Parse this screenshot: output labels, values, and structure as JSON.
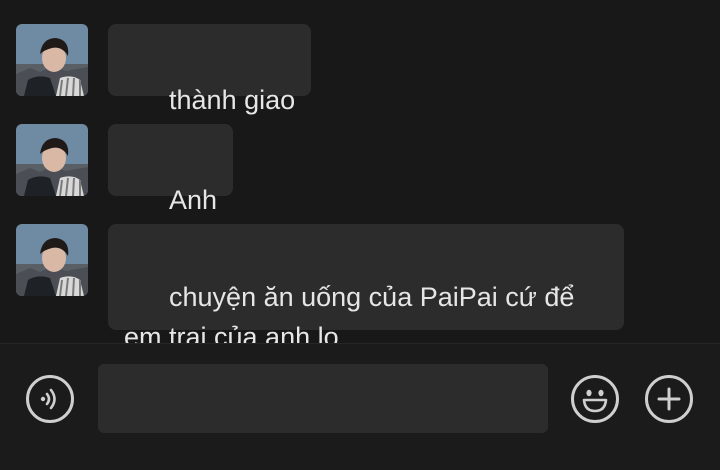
{
  "messages": [
    {
      "text": "thành giao"
    },
    {
      "text": "Anh"
    },
    {
      "text": "chuyện ăn uống của PaiPai cứ để\nem trai của anh lo"
    }
  ],
  "input": {
    "value": "",
    "placeholder": ""
  },
  "icons": {
    "voice": "voice-icon",
    "emoji": "emoji-icon",
    "more": "plus-icon"
  },
  "colors": {
    "background": "#181818",
    "bubble": "#2c2c2c",
    "text": "#e6e6e6",
    "icon": "#cfcfcf"
  }
}
